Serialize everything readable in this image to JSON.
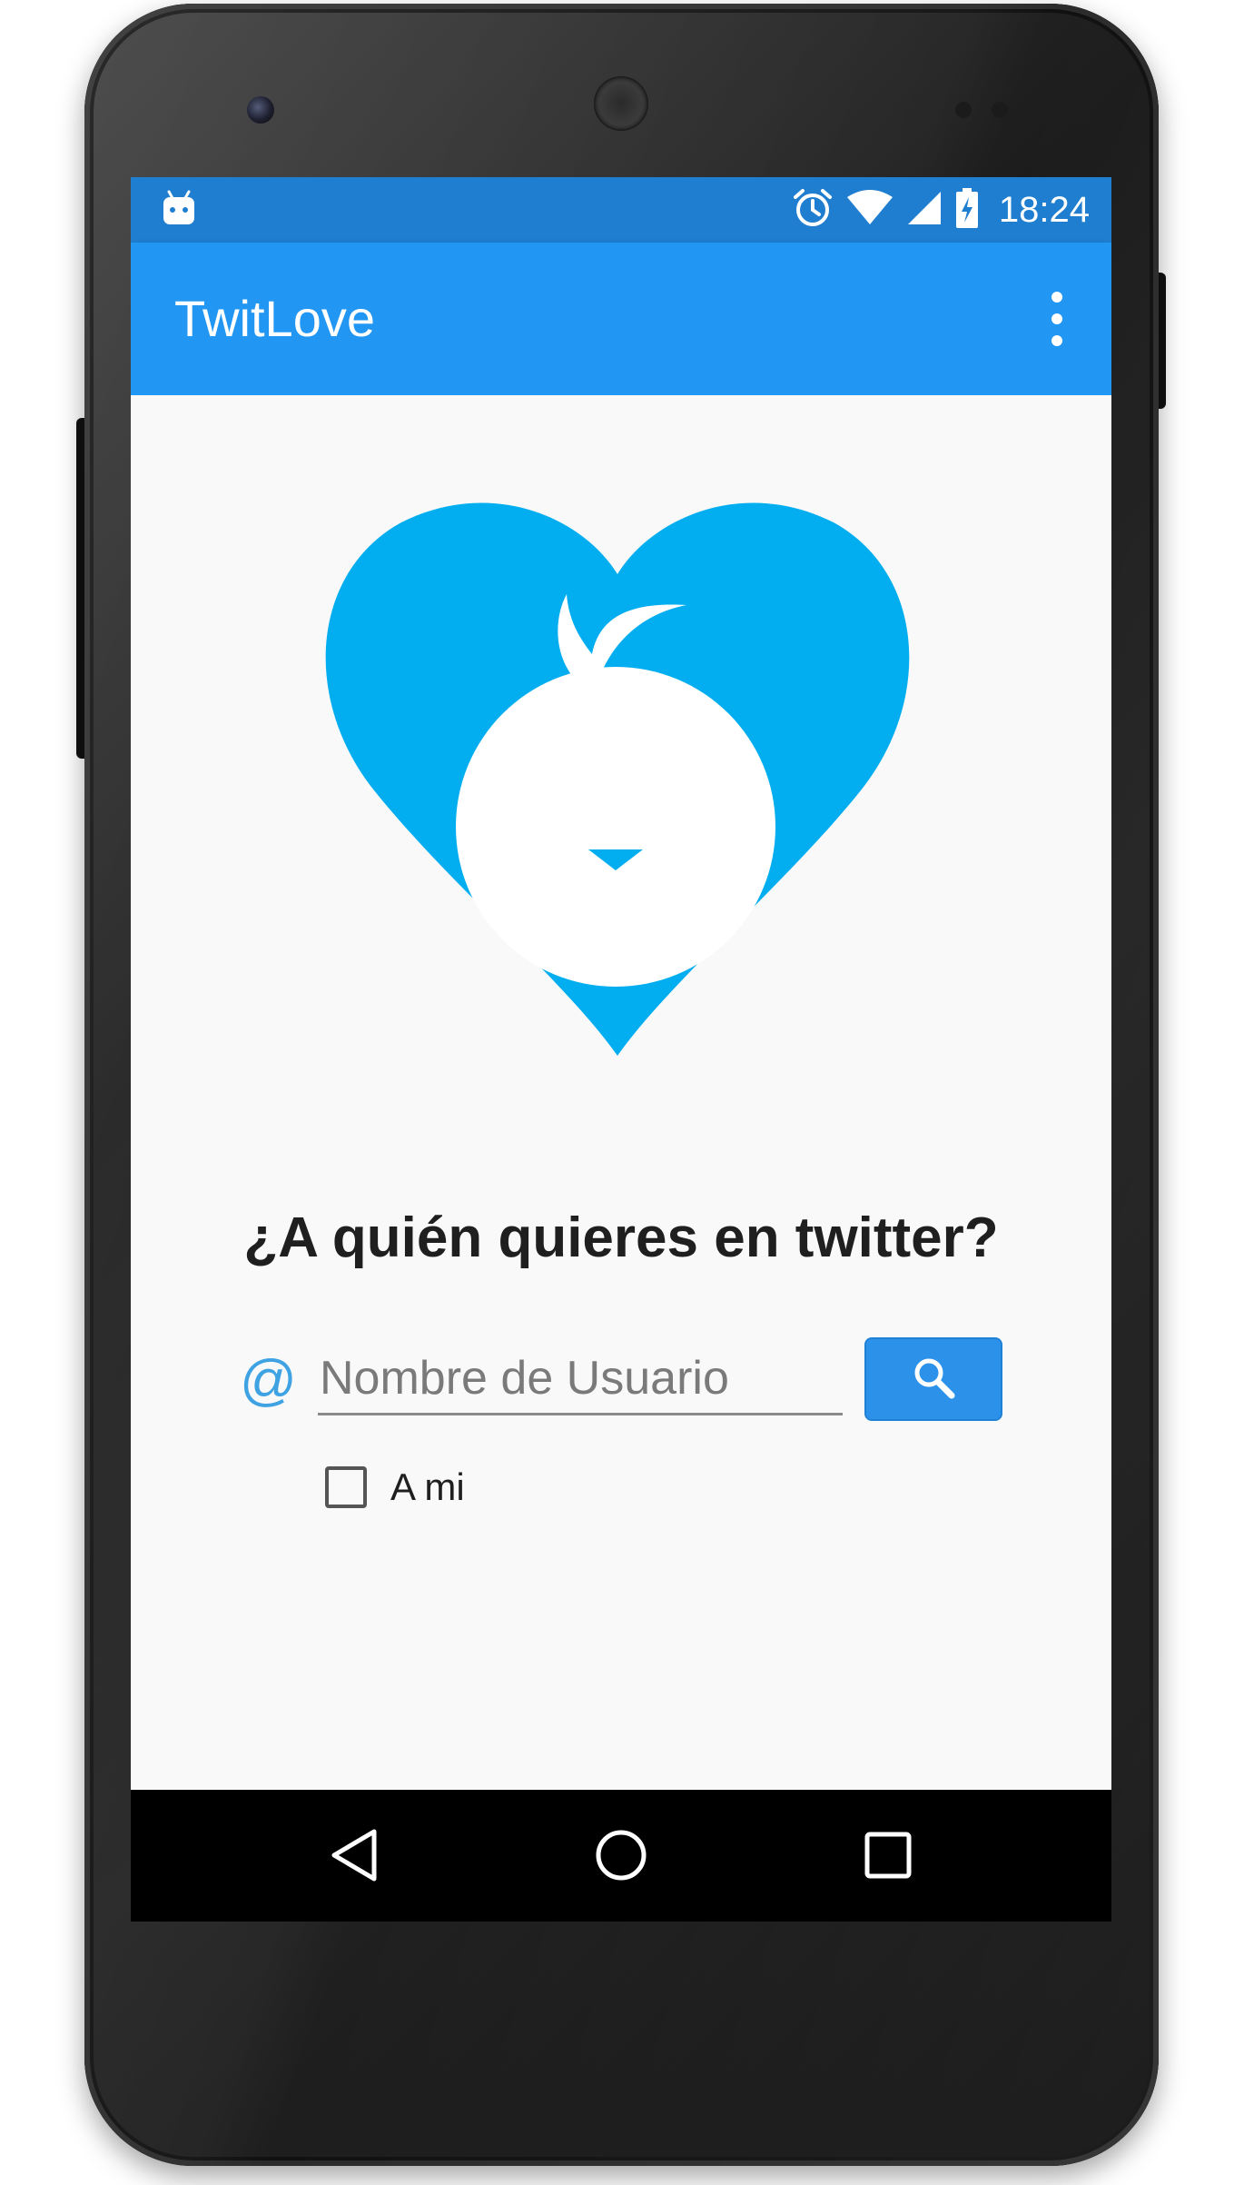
{
  "status_bar": {
    "time": "18:24",
    "icons": [
      "android-icon",
      "alarm-icon",
      "wifi-icon",
      "signal-icon",
      "battery-charging-icon"
    ]
  },
  "app_bar": {
    "title": "TwitLove",
    "menu_icon": "overflow-menu-icon"
  },
  "main": {
    "logo_icon": "heart-bird-logo",
    "question": "¿A quién quieres en twitter?",
    "at_symbol": "@",
    "username_placeholder": "Nombre de Usuario",
    "username_value": "",
    "search_icon": "search-icon",
    "checkbox_label": "A mi",
    "checkbox_checked": false
  },
  "nav_bar": {
    "back_icon": "back-icon",
    "home_icon": "home-icon",
    "recents_icon": "recents-icon"
  },
  "colors": {
    "status_bar": "#1f7ed0",
    "app_bar": "#2196f3",
    "logo_blue": "#03aef0",
    "button_blue": "#2b91e9",
    "at_blue": "#3ea2e3"
  }
}
